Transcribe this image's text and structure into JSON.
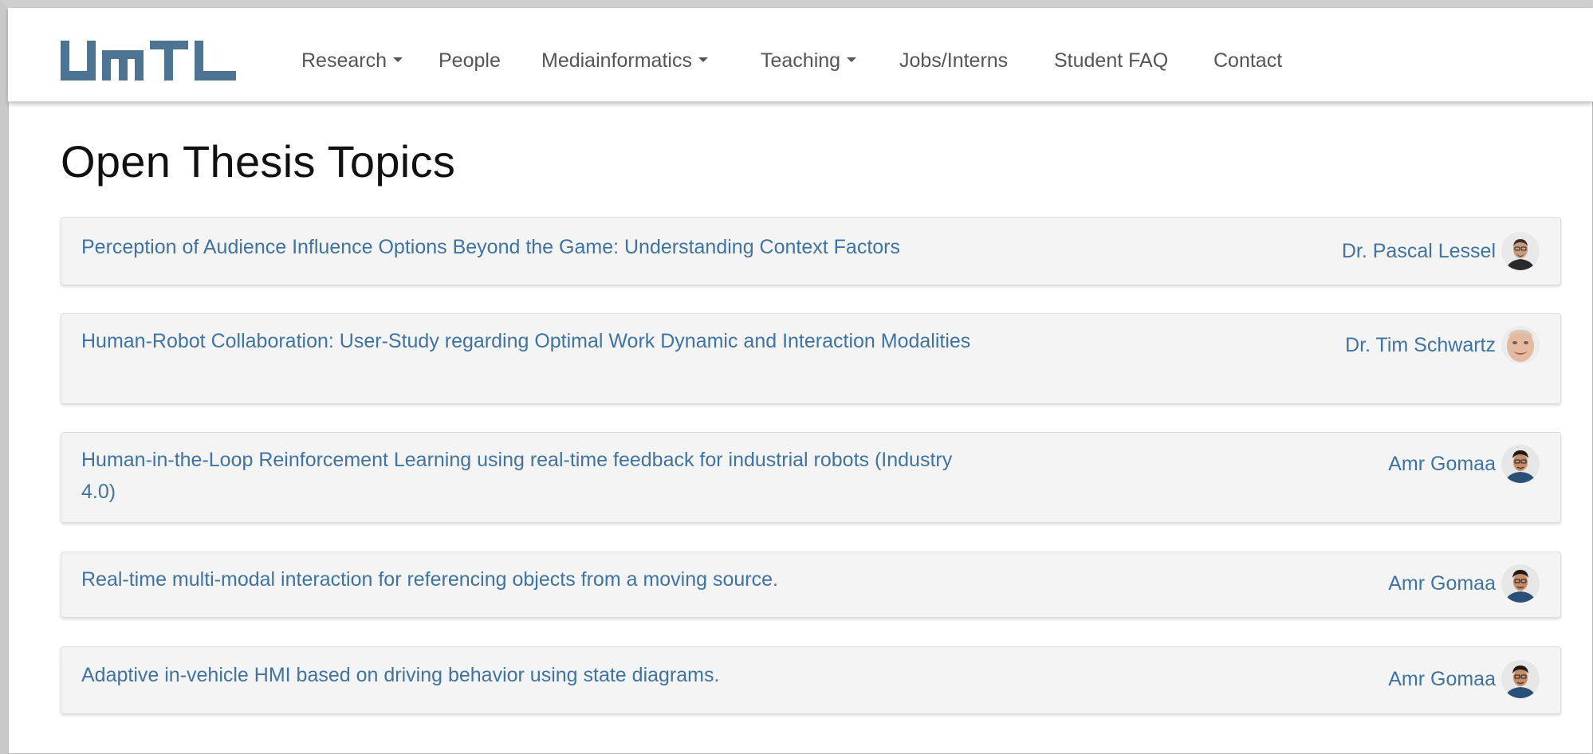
{
  "nav": {
    "logo_text": "UMTL",
    "items": [
      {
        "label": "Research",
        "dropdown": true
      },
      {
        "label": "People",
        "dropdown": false
      },
      {
        "label": "Mediainformatics",
        "dropdown": true
      },
      {
        "label": "Teaching",
        "dropdown": true
      },
      {
        "label": "Jobs/Interns",
        "dropdown": false
      },
      {
        "label": "Student FAQ",
        "dropdown": false
      },
      {
        "label": "Contact",
        "dropdown": false
      }
    ]
  },
  "page": {
    "title": "Open Thesis Topics"
  },
  "topics": [
    {
      "title": "Perception of Audience Influence Options Beyond the Game: Understanding Context Factors",
      "supervisor": "Dr. Pascal Lessel",
      "avatar": "avatar-pascal-lessel"
    },
    {
      "title": "Human-Robot Collaboration: User-Study regarding Optimal Work Dynamic and Interaction Modalities",
      "supervisor": "Dr. Tim Schwartz",
      "avatar": "avatar-tim-schwartz"
    },
    {
      "title": "Human-in-the-Loop Reinforcement Learning using real-time feedback for industrial robots (Industry 4.0)",
      "supervisor": "Amr Gomaa",
      "avatar": "avatar-amr-gomaa"
    },
    {
      "title": "Real-time multi-modal interaction for referencing objects from a moving source.",
      "supervisor": "Amr Gomaa",
      "avatar": "avatar-amr-gomaa"
    },
    {
      "title": "Adaptive in-vehicle HMI based on driving behavior using state diagrams.",
      "supervisor": "Amr Gomaa",
      "avatar": "avatar-amr-gomaa"
    }
  ],
  "colors": {
    "link": "#3f73a3",
    "logo": "#4e7493",
    "nav_text": "#555555",
    "card_bg": "#f4f4f4"
  }
}
